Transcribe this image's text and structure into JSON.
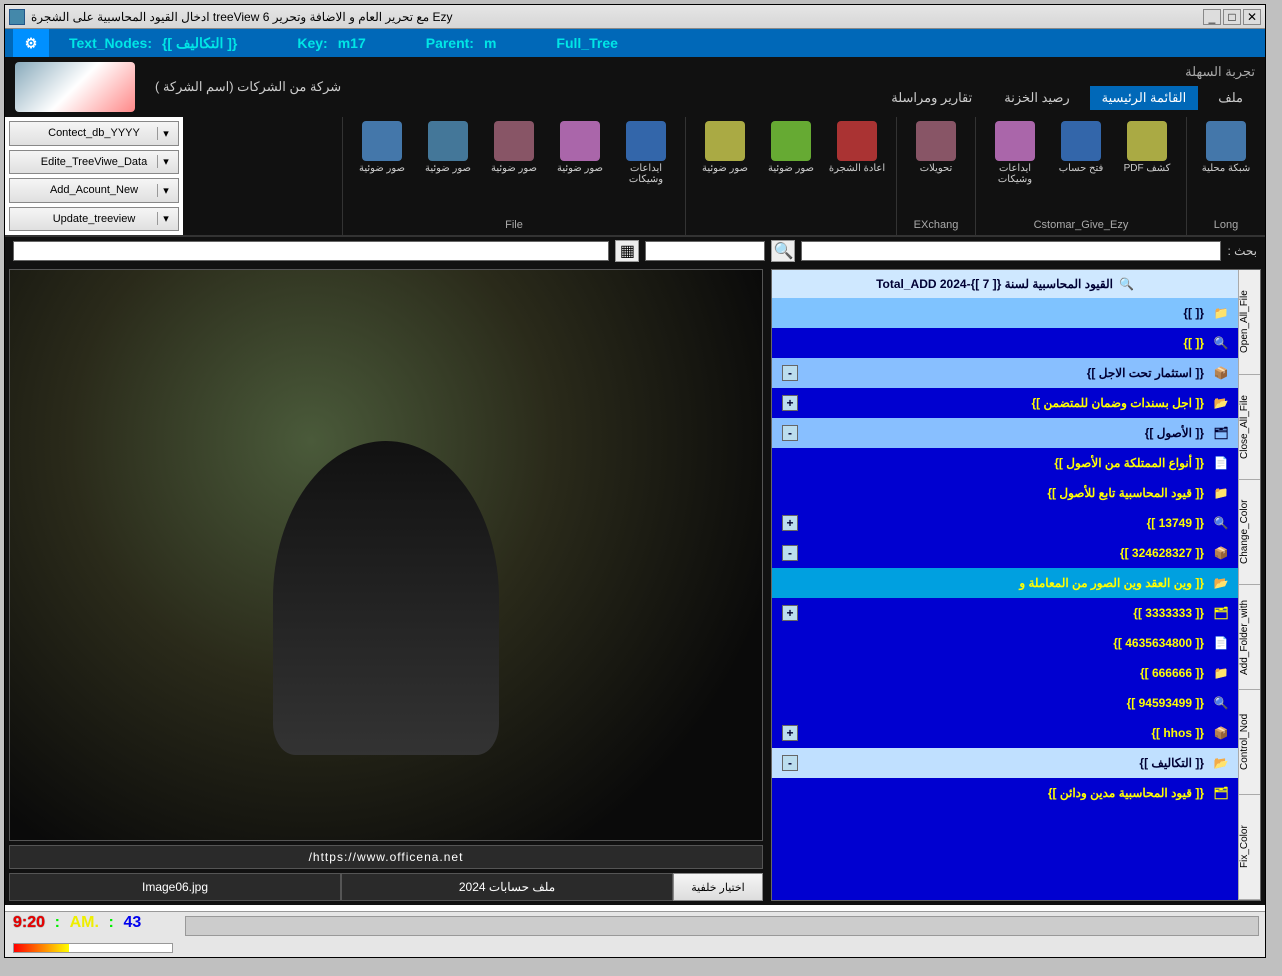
{
  "window": {
    "title": "Ezy مع تحرير العام و الاضافة وتحرير treeView 6 ادخال القيود المحاسبية على الشجرة"
  },
  "info_bar": {
    "text_nodes_label": "Text_Nodes:",
    "text_nodes_value": "{[ التكاليف ]}",
    "key_label": "Key:",
    "key_value": "m17",
    "parent_label": "Parent:",
    "parent_value": "m",
    "full_tree": "Full_Tree"
  },
  "header": {
    "company": "شركة من الشركات (اسم الشركة )",
    "demo": "تجربة السهلة",
    "tabs": [
      "ملف",
      "القائمة الرئيسية",
      "رصيد الخزنة",
      "تقارير ومراسلة"
    ],
    "active_tab_index": 1
  },
  "left_buttons": [
    "Contect_db_YYYY",
    "Edite_TreeViwe_Data",
    "Add_Acount_New",
    "Update_treeview"
  ],
  "ribbon_groups": [
    {
      "label": "Long",
      "items": [
        {
          "t": "شبكة محلية"
        }
      ]
    },
    {
      "label": "Cstomar_Give_Ezy",
      "items": [
        {
          "t": "كشف PDF"
        },
        {
          "t": "فتح حساب"
        },
        {
          "t": "ايداعات وشيكات"
        }
      ]
    },
    {
      "label": "EXchang",
      "items": [
        {
          "t": "تحويلات"
        }
      ]
    },
    {
      "label": "",
      "items": [
        {
          "t": "اعادة الشجرة"
        },
        {
          "t": "صور ضوئية"
        },
        {
          "t": "صور ضوئية"
        }
      ]
    },
    {
      "label": "File",
      "items": [
        {
          "t": "ايداعات وشيكات"
        },
        {
          "t": "صور ضوئية"
        },
        {
          "t": "صور ضوئية"
        },
        {
          "t": "صور ضوئية"
        },
        {
          "t": "صور ضوئية"
        }
      ]
    }
  ],
  "search_label": "بحث :",
  "vtabs": [
    "Open_All_File",
    "Close_All_File",
    "Change_Color",
    "Add_Folder_with",
    "Control_Nod",
    "Fix_Color"
  ],
  "tree": {
    "header": "القيود المحاسبية لسنة Total_ADD 2024-{[ 7 ]}",
    "nodes": [
      {
        "txt": "{[  ]}",
        "cls": "n-lsel",
        "tog": ""
      },
      {
        "txt": "{[  ]}",
        "cls": "n-blue",
        "tog": ""
      },
      {
        "txt": "{[ استثمار تحت الاجل ]}",
        "cls": "n-ltb",
        "tog": "-"
      },
      {
        "txt": "{[ اجل بسندات وضمان للمتضمن ]}",
        "cls": "n-blue",
        "tog": "+"
      },
      {
        "txt": "{[ الأصول ]}",
        "cls": "n-ltb",
        "tog": "-"
      },
      {
        "txt": "{[ أنواع الممتلكة من الأصول ]}",
        "cls": "n-blue",
        "tog": ""
      },
      {
        "txt": "{[ قيود المحاسبية تابع للأصول ]}",
        "cls": "n-blue",
        "tog": ""
      },
      {
        "txt": "{[ 13749 ]}",
        "cls": "n-blue",
        "tog": "+"
      },
      {
        "txt": "{[ 324628327 ]}",
        "cls": "n-blue",
        "tog": "-"
      },
      {
        "txt": "{[ وين العقد وين الصور من المعاملة و",
        "cls": "n-cyan",
        "tog": ""
      },
      {
        "txt": "{[ 3333333 ]}",
        "cls": "n-blue",
        "tog": "+"
      },
      {
        "txt": "{[ 4635634800 ]}",
        "cls": "n-blue",
        "tog": ""
      },
      {
        "txt": "{[ 666666 ]}",
        "cls": "n-blue",
        "tog": ""
      },
      {
        "txt": "{[ 94593499 ]}",
        "cls": "n-blue",
        "tog": ""
      },
      {
        "txt": "{[ hhos ]}",
        "cls": "n-blue",
        "tog": "+"
      },
      {
        "txt": "{[ التكاليف ]}",
        "cls": "n-lsel2",
        "tog": "-"
      },
      {
        "txt": "{[ قيود المحاسبية مدين ودائن ]}",
        "cls": "n-blue",
        "tog": ""
      }
    ]
  },
  "content": {
    "url": "https://www.officena.net/",
    "file_label": "ملف حسابات 2024",
    "image_label": "Image06.jpg",
    "bg_btn": "اختيار خلفية"
  },
  "status": {
    "time": "9:20",
    "sep1": ":",
    "ampm": "AM.",
    "sep2": ":",
    "sec": "43"
  }
}
